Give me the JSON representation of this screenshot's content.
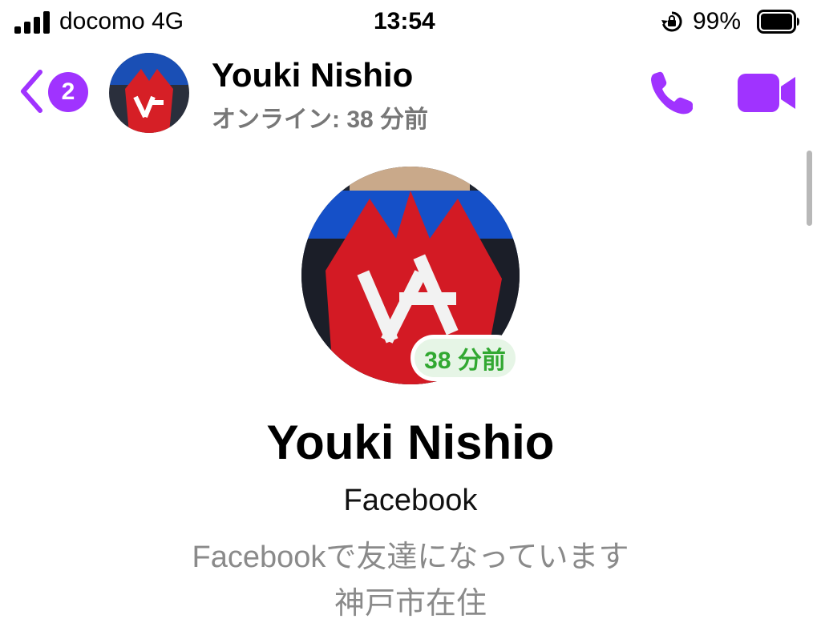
{
  "status_bar": {
    "carrier": "docomo   4G",
    "time": "13:54",
    "battery_percent": "99%",
    "battery_level": 0.99,
    "signal_bars": 4
  },
  "header": {
    "unread_count": "2",
    "contact_name": "Youki  Nishio",
    "presence": "オンライン: 38 分前",
    "accent_color": "#a033ff"
  },
  "profile": {
    "active_label": "38 分前",
    "name": "Youki  Nishio",
    "source": "Facebook",
    "friend_status": "Facebookで友達になっています",
    "location": "神戸市在住"
  },
  "icons": [
    "signal-icon",
    "orientation-lock-icon",
    "battery-icon",
    "back-chevron-icon",
    "phone-icon",
    "video-camera-icon"
  ]
}
